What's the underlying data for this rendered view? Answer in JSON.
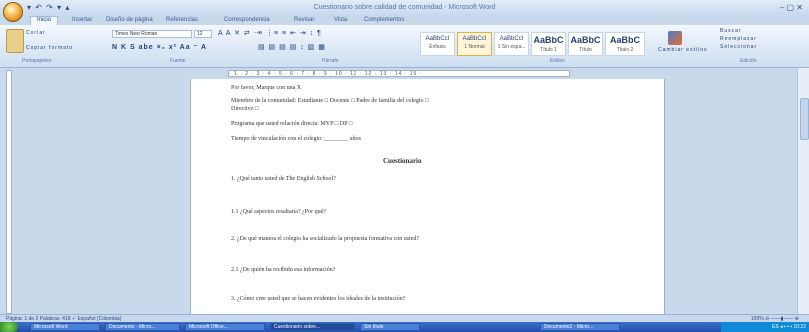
{
  "window": {
    "title": "Cuestionario sobre calidad de comunidad - Microsoft Word",
    "quick_access": "▾ ↶ ↷ ▾ ▴",
    "controls": "– ▢ ✕"
  },
  "ribbon": {
    "tabs": [
      "Inicio",
      "Insertar",
      "Diseño de página",
      "Referencias",
      "Correspondencia",
      "Revisar",
      "Vista",
      "Complementos"
    ],
    "clipboard": {
      "cut": "Cortar",
      "format_painter": "Copiar formato",
      "group": "Portapapeles"
    },
    "font": {
      "name": "Times New Roman",
      "size": "12",
      "group": "Fuente"
    },
    "paragraph": {
      "group": "Párrafo"
    },
    "styles": {
      "group": "Estilos",
      "items": [
        {
          "sample": "AaBbCcI",
          "name": "Énfasis"
        },
        {
          "sample": "AaBbCcI",
          "name": "1 Normal"
        },
        {
          "sample": "AaBbCcI",
          "name": "1 Sin espa..."
        },
        {
          "sample": "AaBbC",
          "name": "Título 1"
        },
        {
          "sample": "AaBbC",
          "name": "Título"
        },
        {
          "sample": "AaBbC",
          "name": "Título 2"
        }
      ],
      "change": "Cambiar estilos"
    },
    "editing": {
      "find": "Buscar",
      "replace": "Reemplazar",
      "select": "Seleccionar",
      "group": "Edición"
    }
  },
  "ruler": {
    "ticks": "· 1 · 2 · 3 · 4 · 5 · 6 · 7 · 8 · 9 · 10 · 11 · 12 · 13 · 14 · 15 ·"
  },
  "document": {
    "lines": [
      "Por favor, Marque con una X",
      "Miembro de la comunidad:  Estudiante  □   Docente  □   Padre de familia del colegio  □",
      "Directivo □",
      "Programa que usted relación directa:   MYP □               DP  □",
      "Tiempo de vinculación con el colegio: ________ años",
      "Cuestionario",
      "1. ¿Qué tanto usted de The English School?",
      "1.1 ¿Qué aspectos resaltaría?  ¿Por qué?",
      "2. ¿De qué manera el colegio ha socializado la propuesta formativa con usted?",
      "2.1 ¿De quién ha recibido esa información?",
      "3. ¿Cómo cree usted que se hacen evidentes los ideales de la institución?"
    ]
  },
  "status": {
    "left": "Página: 1 de 2    Palabras: 418    ✓   Español (Colombia)",
    "zoom": "100%  ⊖ ——▮—— ⊕"
  },
  "taskbar": {
    "items": [
      "Microsoft Word",
      "Documento - Micro...",
      "Microsoft Office...",
      "Cuestionario sobre...",
      "Sin título",
      "Documento2 - Micro..."
    ],
    "tray": "ES  ◂ ▪ ▪ ▪  10:22"
  }
}
